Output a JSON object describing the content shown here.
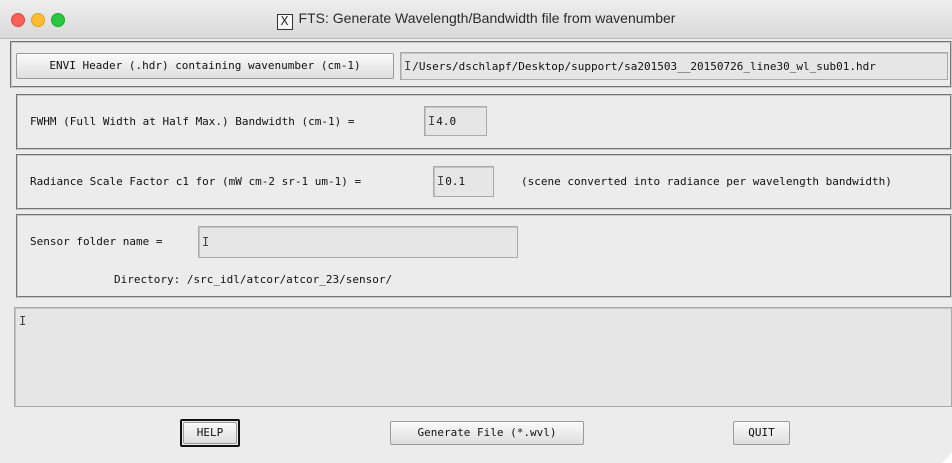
{
  "window": {
    "title": "FTS: Generate Wavelength/Bandwidth file from wavenumber",
    "title_icon": "X"
  },
  "header_file": {
    "button_label": "ENVI Header (.hdr) containing wavenumber (cm-1)",
    "value": "/Users/dschlapf/Desktop/support/sa201503__20150726_line30_wl_sub01.hdr"
  },
  "fwhm": {
    "label": "FWHM (Full Width at Half Max.) Bandwidth (cm-1)  =",
    "value": "4.0"
  },
  "radiance": {
    "label": "Radiance Scale Factor c1 for (mW cm-2 sr-1 um-1)  =",
    "value": "0.1",
    "note": "(scene converted into radiance per wavelength bandwidth)"
  },
  "sensor": {
    "label": "Sensor folder name =",
    "value": "",
    "directory_text": "Directory: /src_idl/atcor/atcor_23/sensor/"
  },
  "log": {
    "text": ""
  },
  "footer": {
    "help_label": "HELP",
    "generate_label": "Generate File (*.wvl)",
    "quit_label": "QUIT"
  },
  "colors": {
    "window_bg": "#ececec",
    "close": "#fc5f57",
    "minimize": "#fdbc2e",
    "maximize": "#28c840"
  }
}
